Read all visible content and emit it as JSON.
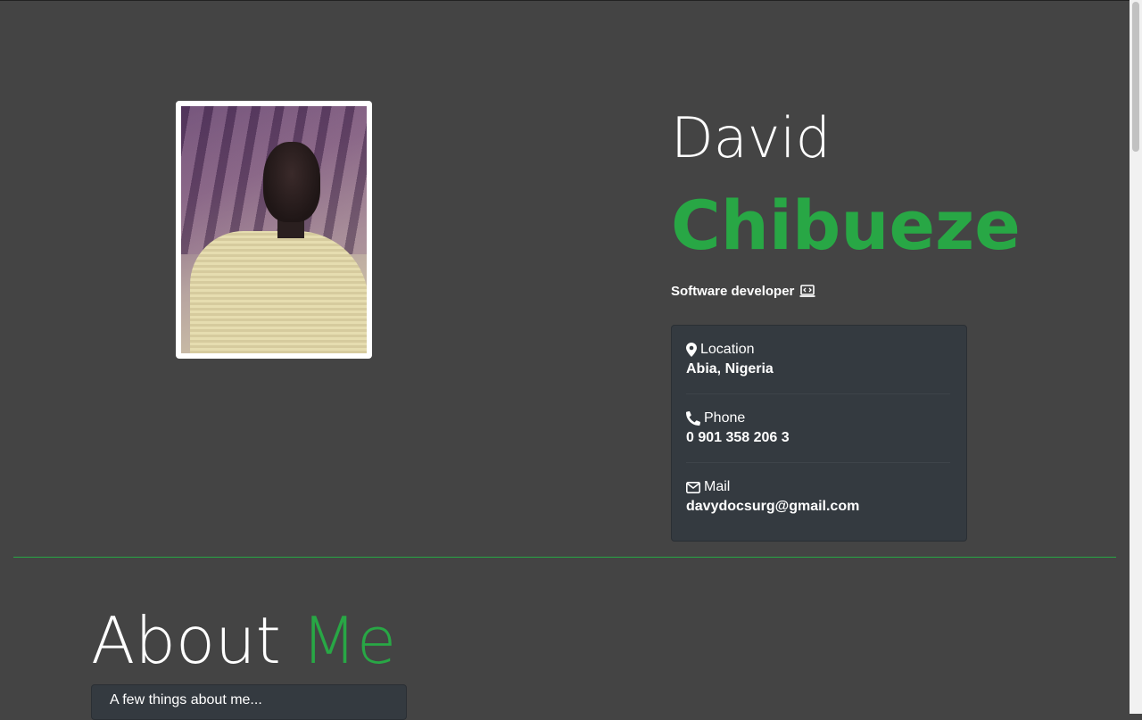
{
  "profile": {
    "first_name": "David",
    "last_name": "Chibueze",
    "role": "Software developer",
    "role_icon": "laptop-code-icon",
    "photo_alt": "profile-photo"
  },
  "contact": {
    "location_label": "Location",
    "location_value": "Abia, Nigeria",
    "phone_label": "Phone",
    "phone_value": "0 901 358 206 3",
    "mail_label": "Mail",
    "mail_value": "davydocsurg@gmail.com"
  },
  "about": {
    "title_part1": "About",
    "title_part2": "Me",
    "card_text": "A few things about me..."
  },
  "colors": {
    "background": "#444444",
    "accent": "#28a745",
    "card": "#343a40"
  }
}
